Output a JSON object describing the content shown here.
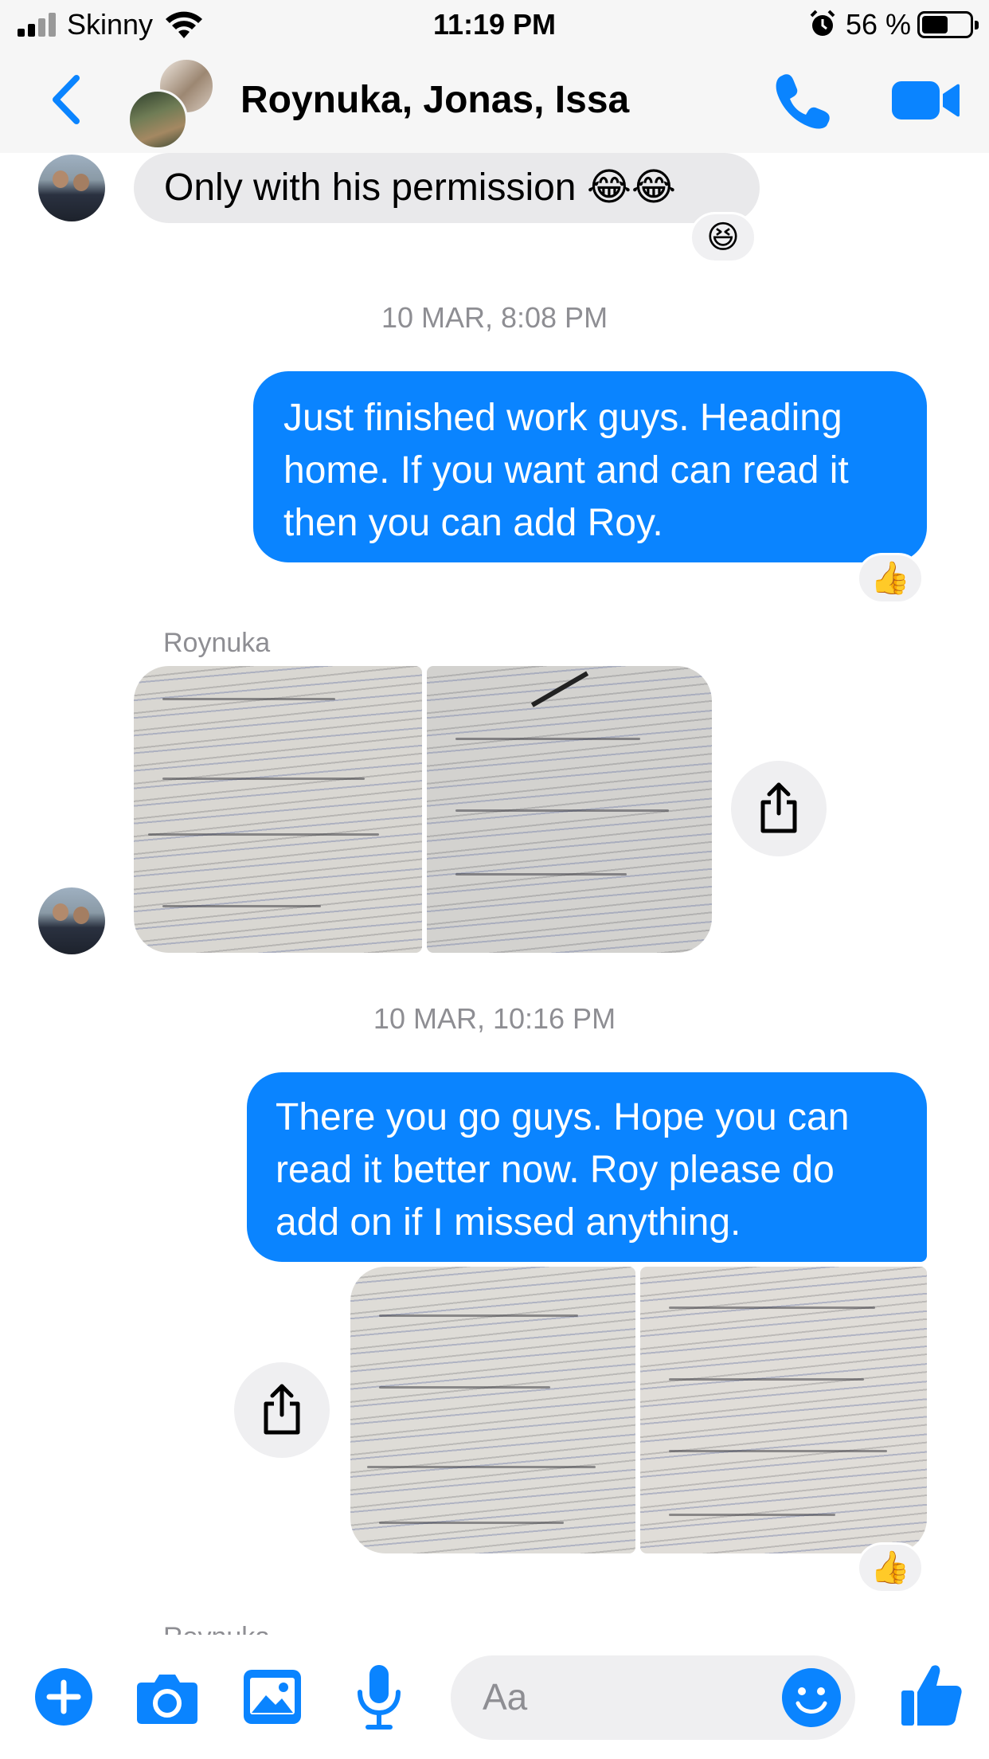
{
  "status_bar": {
    "carrier": "Skinny",
    "time": "11:19 PM",
    "battery_percent_text": "56 %",
    "battery_level": 0.56
  },
  "header": {
    "title": "Roynuka, Jonas, Issa",
    "accent_color": "#0a84ff",
    "icons": [
      "back-chevron-icon",
      "phone-icon",
      "video-camera-icon"
    ]
  },
  "messages": [
    {
      "type": "incoming",
      "text": "Only with his permission 😂😂",
      "reaction": "😆"
    },
    {
      "type": "timestamp",
      "text": "10 MAR, 8:08 PM"
    },
    {
      "type": "outgoing",
      "lines": [
        "Just finished work guys. Heading",
        "home. If you want and can read it",
        "then you can add Roy."
      ],
      "reaction": "👍"
    },
    {
      "type": "incoming-photos",
      "sender": "Roynuka",
      "photo_count": 2
    },
    {
      "type": "timestamp",
      "text": "10 MAR, 10:16 PM"
    },
    {
      "type": "outgoing",
      "lines": [
        "There you go guys. Hope you can",
        "read it better now. Roy please do",
        "add on if I missed anything."
      ]
    },
    {
      "type": "outgoing-photos",
      "photo_count": 2,
      "reaction": "👍"
    },
    {
      "type": "sender-partial",
      "sender": "Roynuka"
    }
  ],
  "composer": {
    "placeholder": "Aa",
    "icons": [
      "plus-icon",
      "camera-icon",
      "gallery-icon",
      "microphone-icon",
      "emoji-icon",
      "like-thumb-icon"
    ]
  }
}
